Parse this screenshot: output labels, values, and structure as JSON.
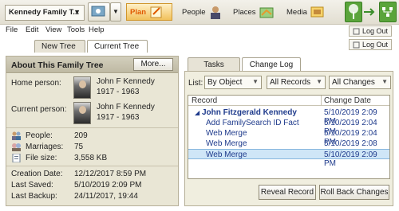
{
  "toolbar": {
    "tree_name": "Kennedy Family T...",
    "plan_label": "Plan",
    "people_label": "People",
    "places_label": "Places",
    "media_label": "Media"
  },
  "menu": {
    "items": [
      "File",
      "Edit",
      "View",
      "Tools",
      "Help"
    ],
    "logout_label": "Log Out"
  },
  "tabs": [
    "New Tree",
    "Current Tree"
  ],
  "about": {
    "title": "About This Family Tree",
    "more_label": "More...",
    "home_person_label": "Home person:",
    "home_person_name": "John F Kennedy",
    "home_person_years": "1917 - 1963",
    "current_person_label": "Current person:",
    "current_person_name": "John F Kennedy",
    "current_person_years": "1917 - 1963",
    "stats": [
      {
        "label": "People:",
        "value": "209",
        "icon": "people-icon"
      },
      {
        "label": "Marriages:",
        "value": "75",
        "icon": "marriages-icon"
      },
      {
        "label": "File size:",
        "value": "3,558 KB",
        "icon": "file-size-icon"
      }
    ],
    "info": [
      {
        "label": "Creation Date:",
        "value": "12/12/2017 8:59 PM"
      },
      {
        "label": "Last Saved:",
        "value": "5/10/2019 2:09 PM"
      },
      {
        "label": "Last Backup:",
        "value": "24/11/2017, 19:44"
      }
    ]
  },
  "changelog": {
    "tabs": [
      "Tasks",
      "Change Log"
    ],
    "list_label": "List:",
    "filters": [
      "By Object",
      "All Records",
      "All Changes"
    ],
    "columns": [
      "Record",
      "Change Date"
    ],
    "rows": [
      {
        "record": "John Fitzgerald Kennedy",
        "date": "5/10/2019 2:09 PM",
        "group": true
      },
      {
        "record": "Add FamilySearch ID Fact",
        "date": "5/10/2019 2:04 PM"
      },
      {
        "record": "Web Merge",
        "date": "5/10/2019 2:04 PM"
      },
      {
        "record": "Web Merge",
        "date": "5/10/2019 2:08 PM"
      },
      {
        "record": "Web Merge",
        "date": "5/10/2019 2:09 PM",
        "selected": true
      }
    ],
    "reveal_label": "Reveal Record",
    "rollback_label": "Roll Back Changes"
  }
}
